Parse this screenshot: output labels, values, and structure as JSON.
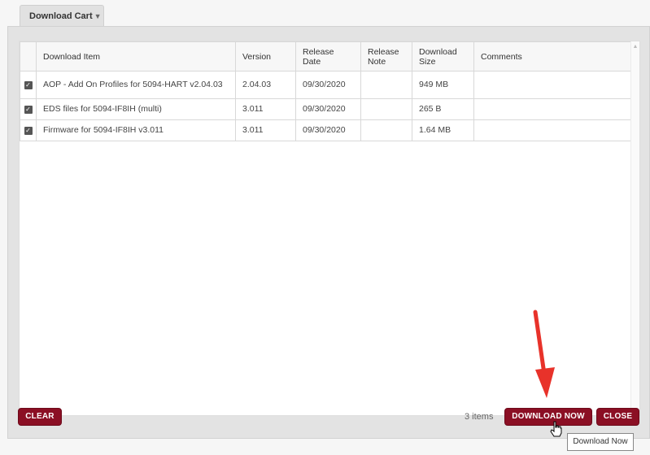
{
  "tab": {
    "label": "Download Cart"
  },
  "table": {
    "headers": [
      "Download Item",
      "Version",
      "Release Date",
      "Release Note",
      "Download Size",
      "Comments"
    ],
    "rows": [
      {
        "checked": true,
        "item": "AOP - Add On Profiles for 5094-HART v2.04.03",
        "version": "2.04.03",
        "release_date": "09/30/2020",
        "release_note": "",
        "size": "949 MB",
        "comments": ""
      },
      {
        "checked": true,
        "item": "EDS files for 5094-IF8IH (multi)",
        "version": "3.011",
        "release_date": "09/30/2020",
        "release_note": "",
        "size": "265 B",
        "comments": ""
      },
      {
        "checked": true,
        "item": "Firmware for 5094-IF8IH v3.011",
        "version": "3.011",
        "release_date": "09/30/2020",
        "release_note": "",
        "size": "1.64 MB",
        "comments": ""
      }
    ]
  },
  "footer": {
    "clear_label": "CLEAR",
    "items_count": "3 items",
    "download_label": "DOWNLOAD NOW",
    "close_label": "CLOSE"
  },
  "tooltip": {
    "text": "Download Now"
  },
  "colors": {
    "button": "#8b0f24",
    "arrow": "#e8322a"
  },
  "icons": {
    "scroll_up": "triangle-up-icon",
    "scroll_down": "triangle-down-icon",
    "cursor": "hand-pointer-icon"
  }
}
